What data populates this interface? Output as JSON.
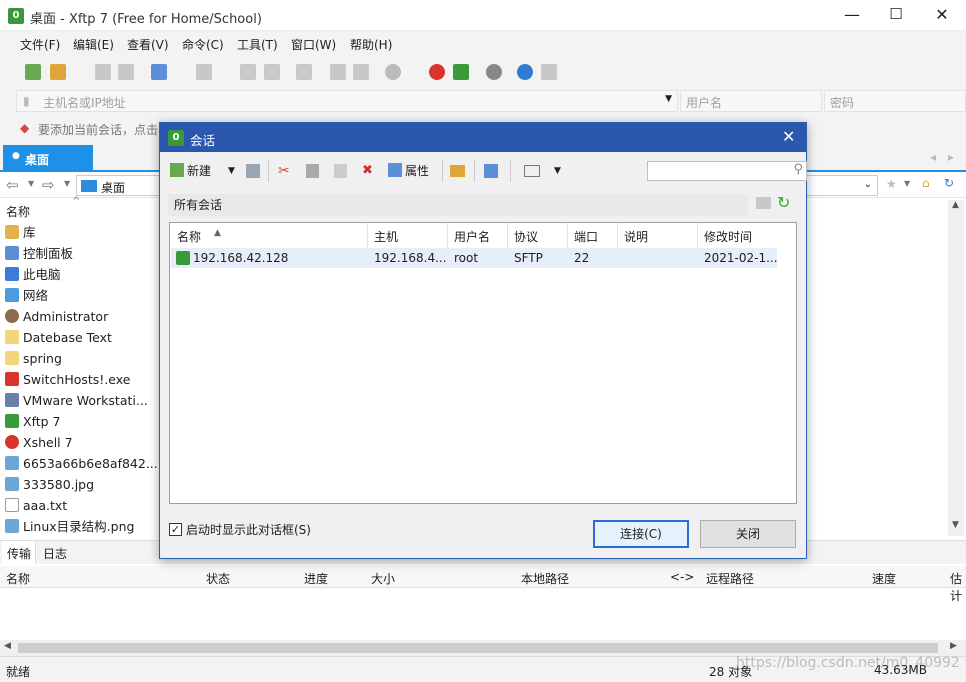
{
  "window": {
    "title": "桌面 - Xftp 7 (Free for Home/School)",
    "app_icon_glyph": "0"
  },
  "menu": [
    "文件(F)",
    "编辑(E)",
    "查看(V)",
    "命令(C)",
    "工具(T)",
    "窗口(W)",
    "帮助(H)"
  ],
  "address_bar": {
    "host_placeholder": "主机名或IP地址",
    "user_placeholder": "用户名",
    "password_placeholder": "密码"
  },
  "hint_text": "要添加当前会话，点击",
  "tabs": {
    "desktop": "桌面"
  },
  "path": {
    "current": "桌面"
  },
  "file_panel": {
    "header": "名称",
    "items": [
      {
        "name": "库",
        "icon": "library-icon"
      },
      {
        "name": "控制面板",
        "icon": "control-panel-icon"
      },
      {
        "name": "此电脑",
        "icon": "computer-icon"
      },
      {
        "name": "网络",
        "icon": "network-icon"
      },
      {
        "name": "Administrator",
        "icon": "user-icon"
      },
      {
        "name": "Datebase Text",
        "icon": "folder-icon"
      },
      {
        "name": "spring",
        "icon": "folder-icon"
      },
      {
        "name": "SwitchHosts!.exe",
        "icon": "exe-icon"
      },
      {
        "name": "VMware Workstati...",
        "icon": "vmware-icon"
      },
      {
        "name": "Xftp 7",
        "icon": "xftp-icon"
      },
      {
        "name": "Xshell 7",
        "icon": "xshell-icon"
      },
      {
        "name": "6653a66b6e8af842...",
        "icon": "image-icon"
      },
      {
        "name": "333580.jpg",
        "icon": "image-icon"
      },
      {
        "name": "aaa.txt",
        "icon": "text-file-icon"
      },
      {
        "name": "Linux目录结构.png",
        "icon": "image-icon"
      }
    ]
  },
  "transfer": {
    "tabs": [
      "传输",
      "日志"
    ],
    "columns": [
      "名称",
      "状态",
      "进度",
      "大小",
      "本地路径",
      "<->",
      "远程路径",
      "速度",
      "估计"
    ]
  },
  "status": {
    "left": "就绪",
    "objects": "28 对象",
    "size": "43.63MB",
    "watermark": "https://blog.csdn.net/m0_40992"
  },
  "dialog": {
    "title": "会话",
    "toolbar": {
      "new_label": "新建",
      "properties_label": "属性"
    },
    "breadcrumb": "所有会话",
    "columns": [
      "名称",
      "主机",
      "用户名",
      "协议",
      "端口",
      "说明",
      "修改时间"
    ],
    "sessions": [
      {
        "name": "192.168.42.128",
        "host": "192.168.4...",
        "user": "root",
        "protocol": "SFTP",
        "port": "22",
        "description": "",
        "modified": "2021-02-1..."
      }
    ],
    "show_on_startup_label": "启动时显示此对话框(S)",
    "show_on_startup_checked": true,
    "connect_label": "连接(C)",
    "close_label": "关闭"
  },
  "colors": {
    "accent": "#1e90e6",
    "dialog_title": "#2b57ac",
    "selection": "#e5eef9"
  }
}
